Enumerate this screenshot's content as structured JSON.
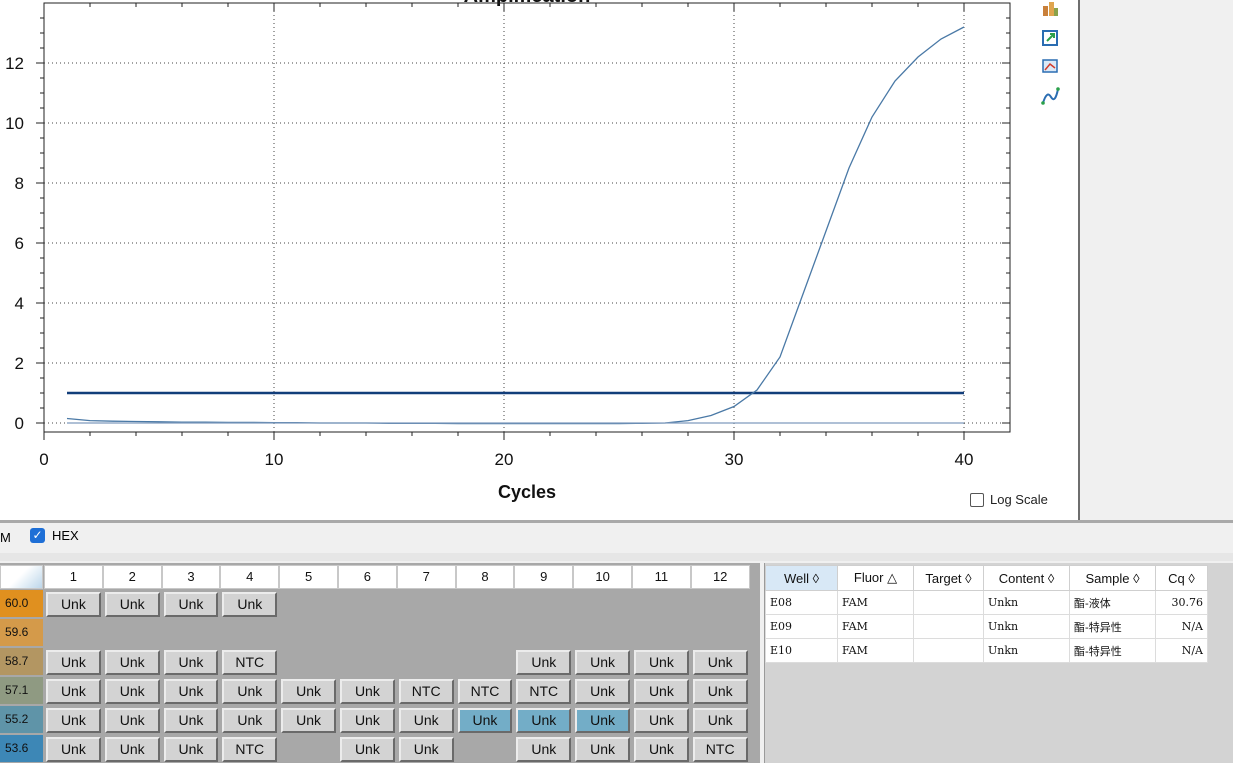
{
  "chart_data": {
    "type": "line",
    "title": "Amplification",
    "xlabel": "Cycles",
    "ylabel": "",
    "xlim": [
      0,
      42
    ],
    "ylim": [
      -0.3,
      14
    ],
    "xticks": [
      0,
      10,
      20,
      30,
      40
    ],
    "yticks": [
      0,
      2,
      4,
      6,
      8,
      10,
      12
    ],
    "grid": "dotted",
    "threshold": 1.0,
    "series": [
      {
        "x": [
          1,
          2,
          3,
          4,
          5,
          6,
          7,
          8,
          9,
          10,
          11,
          12,
          13,
          14,
          15,
          16,
          17,
          18,
          19,
          20,
          21,
          22,
          23,
          24,
          25,
          26,
          27,
          28,
          29,
          30,
          31,
          32,
          33,
          34,
          35,
          36,
          37,
          38,
          39,
          40
        ],
        "values": [
          0.15,
          0.08,
          0.06,
          0.05,
          0.04,
          0.03,
          0.03,
          0.02,
          0.02,
          0.01,
          0.01,
          0.0,
          0.0,
          0.0,
          -0.01,
          -0.01,
          -0.01,
          -0.02,
          -0.02,
          -0.02,
          -0.02,
          -0.02,
          -0.02,
          -0.02,
          -0.02,
          -0.01,
          0.0,
          0.08,
          0.25,
          0.55,
          1.1,
          2.2,
          4.3,
          6.4,
          8.5,
          10.2,
          11.4,
          12.2,
          12.8,
          13.2
        ]
      },
      {
        "x": [
          1,
          5,
          10,
          15,
          20,
          25,
          30,
          35,
          40
        ],
        "values": [
          0.0,
          0.0,
          0.0,
          0.0,
          0.0,
          0.0,
          0.0,
          0.0,
          0.0
        ]
      }
    ]
  },
  "controls": {
    "log_scale_label": "Log Scale"
  },
  "icons": [
    "chart-settings-icon",
    "export-icon",
    "edit-graph-icon",
    "curve-icon"
  ],
  "fluor": {
    "fam_label": "M",
    "hex_label": "HEX"
  },
  "plate": {
    "columns": [
      "1",
      "2",
      "3",
      "4",
      "5",
      "6",
      "7",
      "8",
      "9",
      "10",
      "11",
      "12"
    ],
    "rows": [
      {
        "label": "60.0",
        "color": "#e0901f",
        "cells": [
          "Unk",
          "Unk",
          "Unk",
          "Unk",
          "",
          "",
          "",
          "",
          "",
          "",
          "",
          ""
        ]
      },
      {
        "label": "59.6",
        "color": "#d49a4a",
        "cells": [
          "",
          "",
          "",
          "",
          "",
          "",
          "",
          "",
          "",
          "",
          "",
          ""
        ]
      },
      {
        "label": "58.7",
        "color": "#b39662",
        "cells": [
          "Unk",
          "Unk",
          "Unk",
          "NTC",
          "",
          "",
          "",
          "",
          "Unk",
          "Unk",
          "Unk",
          "Unk"
        ]
      },
      {
        "label": "57.1",
        "color": "#8f9a82",
        "cells": [
          "Unk",
          "Unk",
          "Unk",
          "Unk",
          "Unk",
          "Unk",
          "NTC",
          "NTC",
          "NTC",
          "Unk",
          "Unk",
          "Unk"
        ]
      },
      {
        "label": "55.2",
        "color": "#5f94a8",
        "cells": [
          "Unk",
          "Unk",
          "Unk",
          "Unk",
          "Unk",
          "Unk",
          "Unk",
          "Unk",
          "Unk",
          "Unk",
          "Unk",
          "Unk"
        ]
      },
      {
        "label": "53.6",
        "color": "#3d87b6",
        "cells": [
          "Unk",
          "Unk",
          "Unk",
          "NTC",
          "",
          "Unk",
          "Unk",
          "",
          "Unk",
          "Unk",
          "Unk",
          "NTC"
        ]
      }
    ],
    "selected": [
      [
        4,
        7
      ],
      [
        4,
        8
      ],
      [
        4,
        9
      ]
    ]
  },
  "table": {
    "headers": [
      "Well ◊",
      "Fluor △",
      "Target ◊",
      "Content ◊",
      "Sample ◊",
      "Cq ◊"
    ],
    "rows": [
      [
        "E08",
        "FAM",
        "",
        "Unkn",
        "酯-液体",
        "30.76"
      ],
      [
        "E09",
        "FAM",
        "",
        "Unkn",
        "酯-特异性",
        "N/A"
      ],
      [
        "E10",
        "FAM",
        "",
        "Unkn",
        "酯-特异性",
        "N/A"
      ]
    ]
  }
}
